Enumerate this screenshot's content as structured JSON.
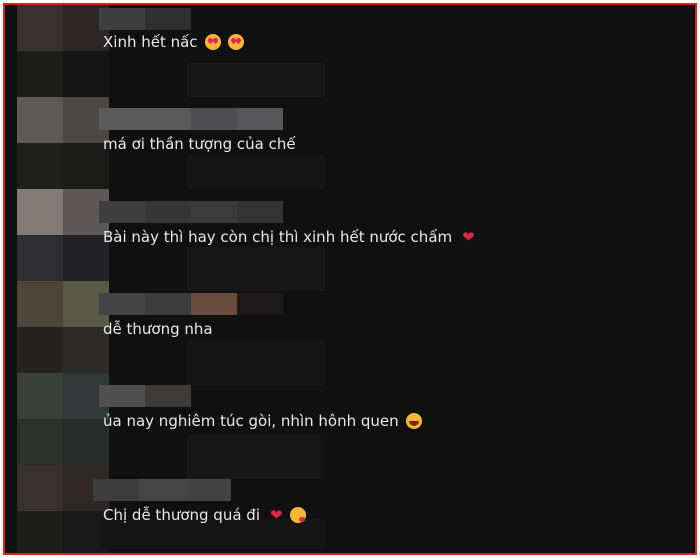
{
  "comments": [
    {
      "text": "Xinh hết nấc",
      "icons": [
        "smiling-face-with-hearts-icon",
        "smiling-face-with-hearts-icon"
      ]
    },
    {
      "text": "má ơi thần tượng của chế",
      "icons": []
    },
    {
      "text": "Bài này thì hay còn chị thì xinh hết nước chấm",
      "icons": [
        "red-heart-icon"
      ]
    },
    {
      "text": "dễ thương nha",
      "icons": []
    },
    {
      "text": "ủa nay nghiêm túc gòi, nhìn hônh quen",
      "icons": [
        "laughing-face-icon"
      ]
    },
    {
      "text": "Chị dễ thương quá đi",
      "icons": [
        "red-heart-icon",
        "face-blowing-kiss-icon"
      ]
    }
  ],
  "colors": {
    "border": "#e11d1d",
    "background": "#101011",
    "text": "#e9e9ea",
    "heart": "#e0244a"
  }
}
